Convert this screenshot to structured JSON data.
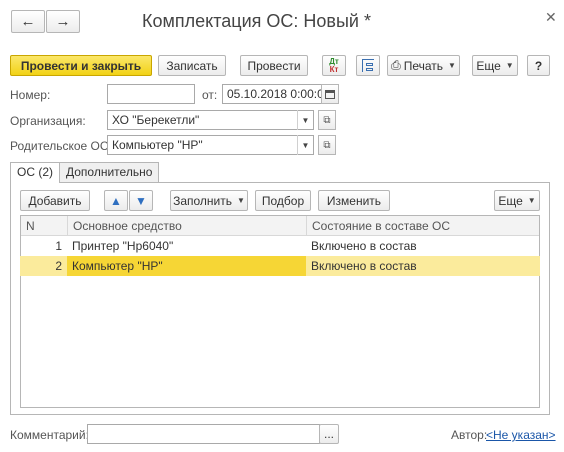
{
  "window": {
    "title": "Комплектация ОС: Новый *"
  },
  "toolbar": {
    "post_close": "Провести и закрыть",
    "save": "Записать",
    "post": "Провести",
    "print": "Печать",
    "more": "Еще",
    "help": "?"
  },
  "form": {
    "number_label": "Номер:",
    "number_value": "",
    "date_label": "от:",
    "date_value": "05.10.2018  0:00:00",
    "org_label": "Организация:",
    "org_value": "ХО \"Берекетли\"",
    "parent_label": "Родительское ОС:",
    "parent_value": "Компьютер \"HP\""
  },
  "tabs": [
    {
      "label": "ОС (2)",
      "active": true
    },
    {
      "label": "Дополнительно",
      "active": false
    }
  ],
  "table_toolbar": {
    "add": "Добавить",
    "fill": "Заполнить",
    "pick": "Подбор",
    "edit": "Изменить",
    "more": "Еще"
  },
  "table": {
    "columns": [
      "N",
      "Основное средство",
      "Состояние в составе ОС"
    ],
    "rows": [
      {
        "n": "1",
        "asset": "Принтер \"Hp6040\"",
        "state": "Включено в состав",
        "selected": false
      },
      {
        "n": "2",
        "asset": "Компьютер \"HP\"",
        "state": "Включено в состав",
        "selected": true
      }
    ]
  },
  "footer": {
    "comment_label": "Комментарий:",
    "comment_value": "",
    "author_label": "Автор:",
    "author_value": "<Не указан>"
  },
  "colors": {
    "accent": "#f2d216",
    "selected_row": "#fbeb9c",
    "selected_cell": "#f6d635",
    "link": "#1a56a8"
  }
}
